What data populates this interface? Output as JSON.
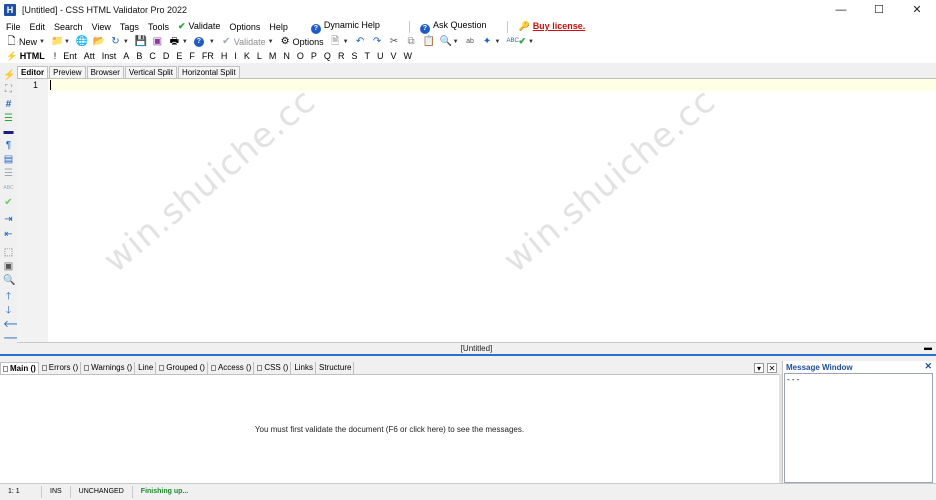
{
  "window": {
    "title": "[Untitled] - CSS HTML Validator Pro 2022",
    "app_icon_letter": "H",
    "minimize": "—",
    "maximize": "☐",
    "close": "✕"
  },
  "menu": {
    "items": [
      {
        "label": "File"
      },
      {
        "label": "Edit"
      },
      {
        "label": "Search"
      },
      {
        "label": "View"
      },
      {
        "label": "Tags"
      },
      {
        "label": "Tools"
      }
    ],
    "validate": "Validate",
    "options": "Options",
    "help": "Help",
    "dynamic_help": "Dynamic Help",
    "ask_question": "Ask Question",
    "buy_license": "Buy license."
  },
  "toolbar": {
    "new": "New",
    "validate": "Validate",
    "options": "Options"
  },
  "tagbar": {
    "label": "HTML",
    "items": [
      "!",
      "Ent",
      "Att",
      "Inst",
      "A",
      "B",
      "C",
      "D",
      "E",
      "F",
      "FR",
      "H",
      "I",
      "K",
      "L",
      "M",
      "N",
      "O",
      "P",
      "Q",
      "R",
      "S",
      "T",
      "U",
      "V",
      "W"
    ]
  },
  "editor": {
    "tabs": [
      "Editor",
      "Preview",
      "Browser",
      "Vertical Split",
      "Horizontal Split"
    ],
    "line_number": "1",
    "doc_title": "[Untitled]"
  },
  "watermark": "win.shuiche.cc",
  "bottom": {
    "tabs": [
      "Main ()",
      "Errors ()",
      "Warnings ()",
      "Line",
      "Grouped ()",
      "Access ()",
      "CSS ()",
      "Links",
      "Structure"
    ],
    "message": "You must first validate the document (F6 or click here) to see the messages."
  },
  "message_window": {
    "title": "Message Window",
    "content": "- - -"
  },
  "status": {
    "position": "1: 1",
    "mode": "INS",
    "state": "UNCHANGED",
    "progress": "Finishing up..."
  },
  "colors": {
    "accent_blue": "#2a6fd2",
    "buy_red": "#d01010",
    "finish_green": "#1a8a2a",
    "current_line": "#ffffe6"
  }
}
